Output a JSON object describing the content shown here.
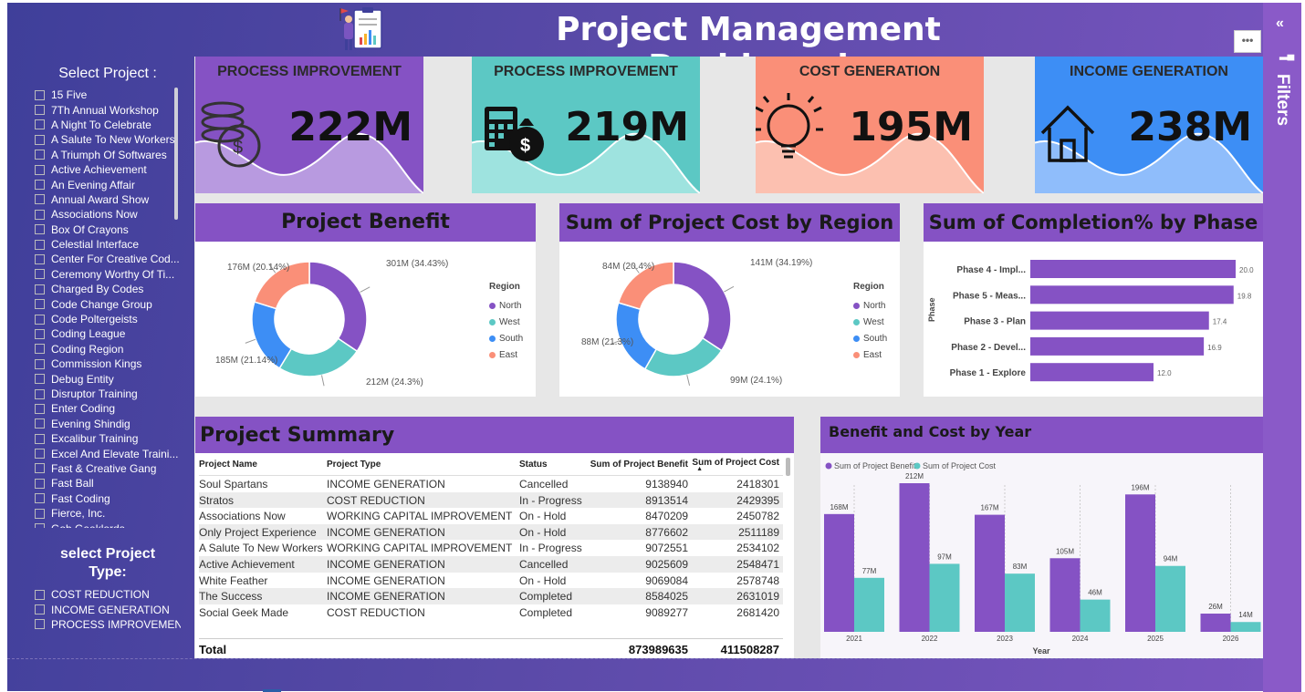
{
  "header": {
    "title": "Project Management Dashboard",
    "more_label": "•••"
  },
  "filters_pane": {
    "label": "Filters",
    "collapse_icon": "«"
  },
  "slicer_project": {
    "title": "Select Project :",
    "items": [
      "15 Five",
      "7Th Annual Workshop",
      "A Night To Celebrate",
      "A Salute To New Workers",
      "A Triumph Of Softwares",
      "Active Achievement",
      "An Evening Affair",
      "Annual Award Show",
      "Associations Now",
      "Box Of Crayons",
      "Celestial Interface",
      "Center For Creative Cod...",
      "Ceremony Worthy Of Ti...",
      "Charged By Codes",
      "Code Change Group",
      "Code Poltergeists",
      "Coding League",
      "Coding Region",
      "Commission Kings",
      "Debug Entity",
      "Disruptor Training",
      "Enter Coding",
      "Evening Shindig",
      "Excalibur Training",
      "Excel And Elevate Traini...",
      "Fast & Creative Gang",
      "Fast Ball",
      "Fast Coding",
      "Fierce, Inc.",
      "Gob Geeklords"
    ]
  },
  "slicer_type": {
    "title": "select Project Type:",
    "items": [
      "COST REDUCTION",
      "INCOME GENERATION",
      "PROCESS IMPROVEMENT"
    ]
  },
  "kpis": [
    {
      "label": "PROCESS IMPROVEMENT",
      "value": "222M",
      "color": "#8552c4",
      "wave": "#b89ae0",
      "icon": "coins-icon"
    },
    {
      "label": "PROCESS IMPROVEMENT",
      "value": "219M",
      "color": "#5cc8c4",
      "wave": "#9ee3df",
      "icon": "calculator-money-icon"
    },
    {
      "label": "COST GENERATION",
      "value": "195M",
      "color": "#fa8f78",
      "wave": "#fcc0b0",
      "icon": "lightbulb-icon"
    },
    {
      "label": "INCOME GENERATION",
      "value": "238M",
      "color": "#3d8ef5",
      "wave": "#8fbdfb",
      "icon": "house-icon"
    }
  ],
  "benefit_donut": {
    "title": "Project Benefit",
    "legend_title": "Region",
    "legend": [
      "North",
      "West",
      "South",
      "East"
    ],
    "labels": [
      "301M (34.43%)",
      "212M (24.3%)",
      "185M (21.14%)",
      "176M (20.14%)"
    ]
  },
  "cost_donut": {
    "title": "Sum of Project Cost by Region",
    "legend_title": "Region",
    "legend": [
      "North",
      "West",
      "South",
      "East"
    ],
    "labels": [
      "141M (34.19%)",
      "99M (24.1%)",
      "88M (21.3%)",
      "84M (20.4%)"
    ]
  },
  "colors": {
    "north": "#8552c4",
    "west": "#5cc8c4",
    "south": "#3d8ef5",
    "east": "#fa8f78",
    "header": "#8552c4"
  },
  "phase_chart": {
    "title": "Sum of Completion% by Phase",
    "axis_label": "Phase"
  },
  "summary": {
    "title": "Project Summary",
    "columns": [
      "Project Name",
      "Project Type",
      "Status",
      "Sum of Project Benefit",
      "Sum of Project Cost"
    ],
    "rows": [
      [
        "Soul Spartans",
        "INCOME GENERATION",
        "Cancelled",
        "9138940",
        "2418301"
      ],
      [
        "Stratos",
        "COST REDUCTION",
        "In - Progress",
        "8913514",
        "2429395"
      ],
      [
        "Associations Now",
        "WORKING CAPITAL IMPROVEMENT",
        "On - Hold",
        "8470209",
        "2450782"
      ],
      [
        "Only Project Experience",
        "INCOME GENERATION",
        "On - Hold",
        "8776602",
        "2511189"
      ],
      [
        "A Salute To New Workers",
        "WORKING CAPITAL IMPROVEMENT",
        "In - Progress",
        "9072551",
        "2534102"
      ],
      [
        "Active Achievement",
        "INCOME GENERATION",
        "Cancelled",
        "9025609",
        "2548471"
      ],
      [
        "White Feather",
        "INCOME GENERATION",
        "On - Hold",
        "9069084",
        "2578748"
      ],
      [
        "The Success",
        "INCOME GENERATION",
        "Completed",
        "8584025",
        "2631019"
      ],
      [
        "Social Geek Made",
        "COST REDUCTION",
        "Completed",
        "9089277",
        "2681420"
      ]
    ],
    "total_label": "Total",
    "total_benefit": "873989635",
    "total_cost": "411508287"
  },
  "chart_data": [
    {
      "type": "pie",
      "title": "Project Benefit",
      "categories": [
        "North",
        "West",
        "South",
        "East"
      ],
      "values": [
        301,
        212,
        185,
        176
      ],
      "percent": [
        34.43,
        24.3,
        21.14,
        20.14
      ]
    },
    {
      "type": "pie",
      "title": "Sum of Project Cost by Region",
      "categories": [
        "North",
        "West",
        "South",
        "East"
      ],
      "values": [
        141,
        99,
        88,
        84
      ],
      "percent": [
        34.19,
        24.1,
        21.3,
        20.4
      ]
    },
    {
      "type": "bar",
      "title": "Sum of Completion% by Phase",
      "ylabel": "Phase",
      "categories": [
        "Phase 4 - Impl...",
        "Phase 5 - Meas...",
        "Phase 3 - Plan",
        "Phase 2 - Devel...",
        "Phase 1 - Explore"
      ],
      "values": [
        20.0,
        19.8,
        17.4,
        16.9,
        12.0
      ],
      "value_labels": [
        "20.0",
        "19.8",
        "17.4",
        "16.9",
        "12.0"
      ]
    },
    {
      "type": "bar",
      "title": "Benefit and  Cost by Year",
      "xlabel": "Year",
      "categories": [
        "2021",
        "2022",
        "2023",
        "2024",
        "2025",
        "2026"
      ],
      "series": [
        {
          "name": "Sum of Project Benefit",
          "values": [
            168,
            212,
            167,
            105,
            196,
            26
          ],
          "labels": [
            "168M",
            "212M",
            "167M",
            "105M",
            "196M",
            "26M"
          ]
        },
        {
          "name": "Sum of Project Cost",
          "values": [
            77,
            97,
            83,
            46,
            94,
            14
          ],
          "labels": [
            "77M",
            "97M",
            "83M",
            "46M",
            "94M",
            "14M"
          ]
        }
      ]
    }
  ]
}
